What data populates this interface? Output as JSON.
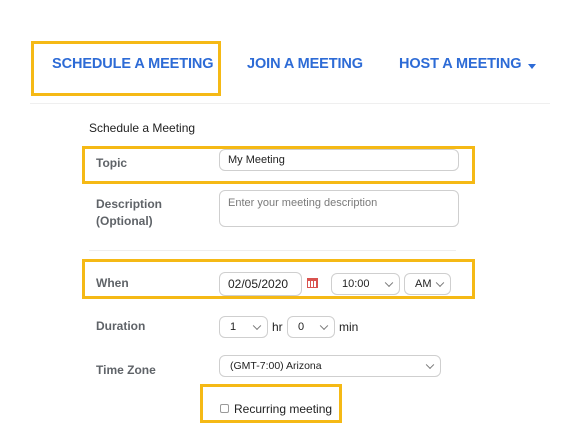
{
  "nav": {
    "schedule": "SCHEDULE A MEETING",
    "join": "JOIN A MEETING",
    "host": "HOST A MEETING"
  },
  "form": {
    "section_title": "Schedule a Meeting",
    "topic": {
      "label": "Topic",
      "value": "My Meeting"
    },
    "description": {
      "label_line1": "Description",
      "label_line2": "(Optional)",
      "placeholder": "Enter your meeting description"
    },
    "when": {
      "label": "When",
      "date": "02/05/2020",
      "time": "10:00",
      "ampm": "AM"
    },
    "duration": {
      "label": "Duration",
      "hours": "1",
      "hours_unit": "hr",
      "minutes": "0",
      "minutes_unit": "min"
    },
    "time_zone": {
      "label": "Time Zone",
      "value": "(GMT-7:00) Arizona"
    },
    "recurring": {
      "label": "Recurring meeting",
      "checked": false
    }
  },
  "colors": {
    "nav_link": "#2d6bd6",
    "highlight": "#f5b915",
    "calendar_icon": "#d9534f"
  }
}
